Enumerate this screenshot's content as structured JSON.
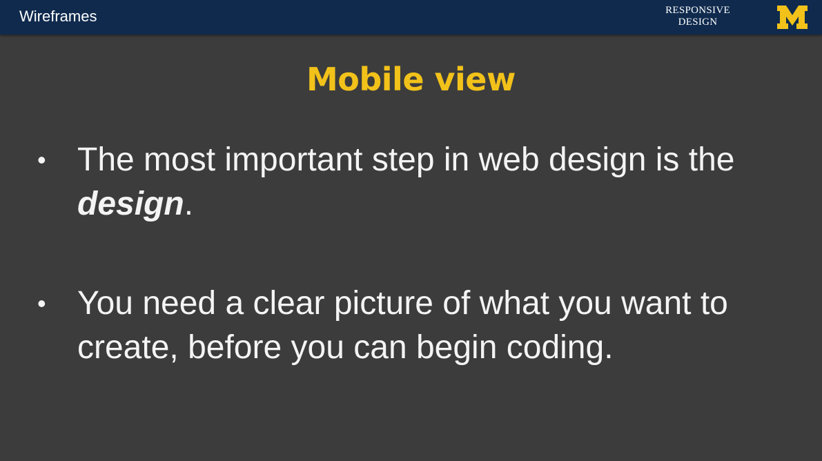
{
  "header": {
    "title": "Wireframes",
    "course_line1": "RESPONSIVE",
    "course_line2": "DESIGN",
    "logo_letter": "M",
    "logo_color": "#f2c21a",
    "bar_color": "#0f2a4d"
  },
  "slide": {
    "title": "Mobile view",
    "title_color": "#f2c21a",
    "bullets": [
      {
        "text_before": "The most important step in web design is the ",
        "emphasis": "design",
        "text_after": "."
      },
      {
        "text": "You need a clear picture of what you want to create, before you can begin coding."
      }
    ],
    "bullet_marker": "•"
  }
}
